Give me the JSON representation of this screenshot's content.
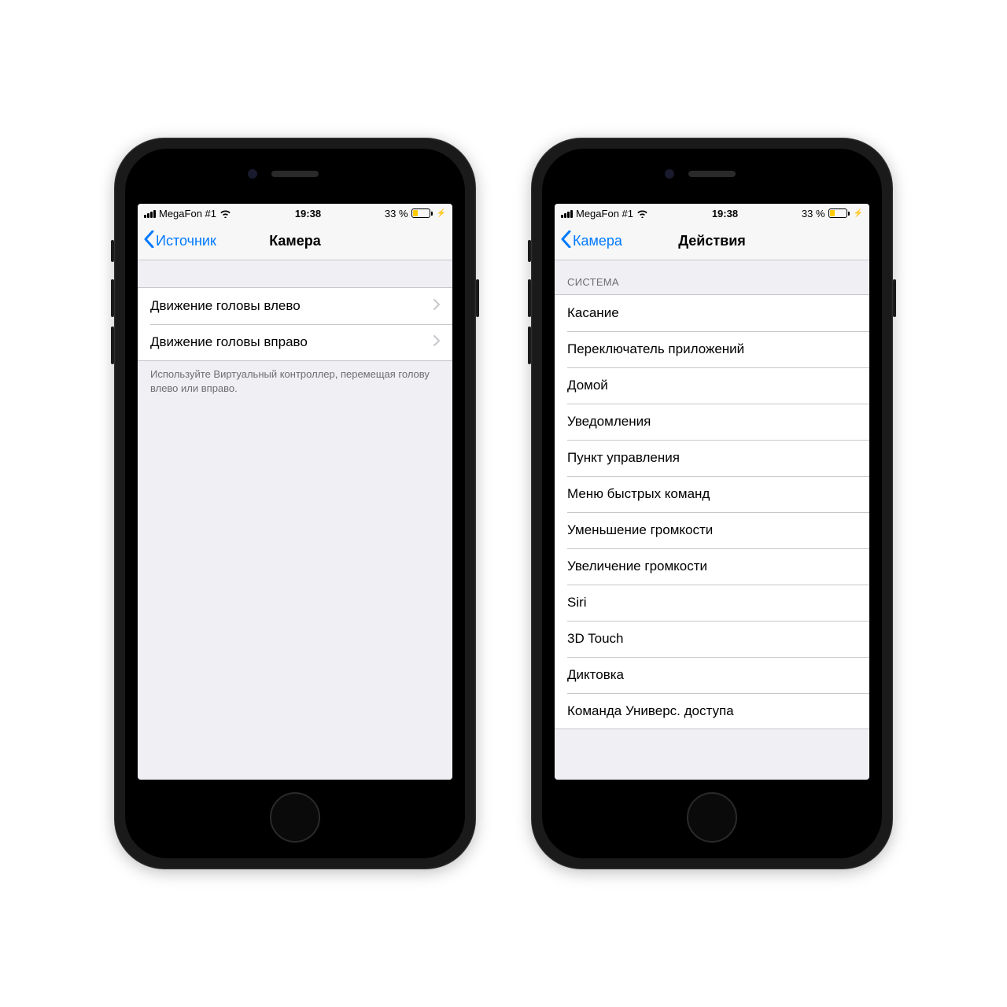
{
  "status": {
    "carrier": "MegaFon #1",
    "time": "19:38",
    "battery_pct": "33 %"
  },
  "left_phone": {
    "back_label": "Источник",
    "title": "Камера",
    "rows": [
      {
        "label": "Движение головы влево"
      },
      {
        "label": "Движение головы вправо"
      }
    ],
    "footer": "Используйте Виртуальный контроллер, перемещая голову влево или вправо."
  },
  "right_phone": {
    "back_label": "Камера",
    "title": "Действия",
    "section_header": "СИСТЕМА",
    "rows": [
      {
        "label": "Касание"
      },
      {
        "label": "Переключатель приложений"
      },
      {
        "label": "Домой"
      },
      {
        "label": "Уведомления"
      },
      {
        "label": "Пункт управления"
      },
      {
        "label": "Меню быстрых команд"
      },
      {
        "label": "Уменьшение громкости"
      },
      {
        "label": "Увеличение громкости"
      },
      {
        "label": "Siri"
      },
      {
        "label": "3D Touch"
      },
      {
        "label": "Диктовка"
      },
      {
        "label": "Команда Универс. доступа"
      }
    ]
  }
}
